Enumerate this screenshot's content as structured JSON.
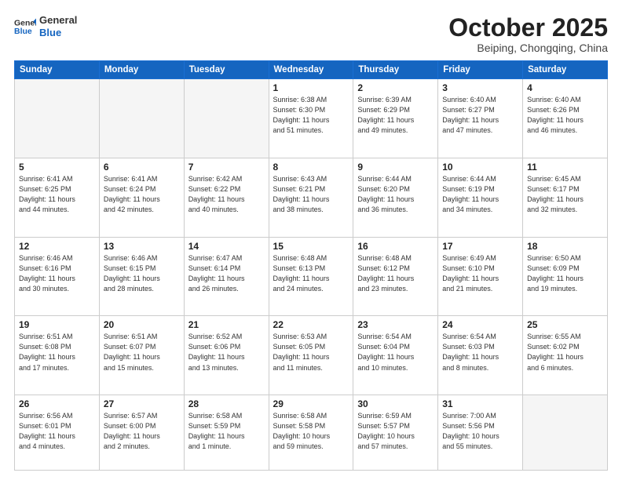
{
  "header": {
    "logo_line1": "General",
    "logo_line2": "Blue",
    "month_title": "October 2025",
    "location": "Beiping, Chongqing, China"
  },
  "weekdays": [
    "Sunday",
    "Monday",
    "Tuesday",
    "Wednesday",
    "Thursday",
    "Friday",
    "Saturday"
  ],
  "weeks": [
    [
      {
        "num": "",
        "info": ""
      },
      {
        "num": "",
        "info": ""
      },
      {
        "num": "",
        "info": ""
      },
      {
        "num": "1",
        "info": "Sunrise: 6:38 AM\nSunset: 6:30 PM\nDaylight: 11 hours\nand 51 minutes."
      },
      {
        "num": "2",
        "info": "Sunrise: 6:39 AM\nSunset: 6:29 PM\nDaylight: 11 hours\nand 49 minutes."
      },
      {
        "num": "3",
        "info": "Sunrise: 6:40 AM\nSunset: 6:27 PM\nDaylight: 11 hours\nand 47 minutes."
      },
      {
        "num": "4",
        "info": "Sunrise: 6:40 AM\nSunset: 6:26 PM\nDaylight: 11 hours\nand 46 minutes."
      }
    ],
    [
      {
        "num": "5",
        "info": "Sunrise: 6:41 AM\nSunset: 6:25 PM\nDaylight: 11 hours\nand 44 minutes."
      },
      {
        "num": "6",
        "info": "Sunrise: 6:41 AM\nSunset: 6:24 PM\nDaylight: 11 hours\nand 42 minutes."
      },
      {
        "num": "7",
        "info": "Sunrise: 6:42 AM\nSunset: 6:22 PM\nDaylight: 11 hours\nand 40 minutes."
      },
      {
        "num": "8",
        "info": "Sunrise: 6:43 AM\nSunset: 6:21 PM\nDaylight: 11 hours\nand 38 minutes."
      },
      {
        "num": "9",
        "info": "Sunrise: 6:44 AM\nSunset: 6:20 PM\nDaylight: 11 hours\nand 36 minutes."
      },
      {
        "num": "10",
        "info": "Sunrise: 6:44 AM\nSunset: 6:19 PM\nDaylight: 11 hours\nand 34 minutes."
      },
      {
        "num": "11",
        "info": "Sunrise: 6:45 AM\nSunset: 6:17 PM\nDaylight: 11 hours\nand 32 minutes."
      }
    ],
    [
      {
        "num": "12",
        "info": "Sunrise: 6:46 AM\nSunset: 6:16 PM\nDaylight: 11 hours\nand 30 minutes."
      },
      {
        "num": "13",
        "info": "Sunrise: 6:46 AM\nSunset: 6:15 PM\nDaylight: 11 hours\nand 28 minutes."
      },
      {
        "num": "14",
        "info": "Sunrise: 6:47 AM\nSunset: 6:14 PM\nDaylight: 11 hours\nand 26 minutes."
      },
      {
        "num": "15",
        "info": "Sunrise: 6:48 AM\nSunset: 6:13 PM\nDaylight: 11 hours\nand 24 minutes."
      },
      {
        "num": "16",
        "info": "Sunrise: 6:48 AM\nSunset: 6:12 PM\nDaylight: 11 hours\nand 23 minutes."
      },
      {
        "num": "17",
        "info": "Sunrise: 6:49 AM\nSunset: 6:10 PM\nDaylight: 11 hours\nand 21 minutes."
      },
      {
        "num": "18",
        "info": "Sunrise: 6:50 AM\nSunset: 6:09 PM\nDaylight: 11 hours\nand 19 minutes."
      }
    ],
    [
      {
        "num": "19",
        "info": "Sunrise: 6:51 AM\nSunset: 6:08 PM\nDaylight: 11 hours\nand 17 minutes."
      },
      {
        "num": "20",
        "info": "Sunrise: 6:51 AM\nSunset: 6:07 PM\nDaylight: 11 hours\nand 15 minutes."
      },
      {
        "num": "21",
        "info": "Sunrise: 6:52 AM\nSunset: 6:06 PM\nDaylight: 11 hours\nand 13 minutes."
      },
      {
        "num": "22",
        "info": "Sunrise: 6:53 AM\nSunset: 6:05 PM\nDaylight: 11 hours\nand 11 minutes."
      },
      {
        "num": "23",
        "info": "Sunrise: 6:54 AM\nSunset: 6:04 PM\nDaylight: 11 hours\nand 10 minutes."
      },
      {
        "num": "24",
        "info": "Sunrise: 6:54 AM\nSunset: 6:03 PM\nDaylight: 11 hours\nand 8 minutes."
      },
      {
        "num": "25",
        "info": "Sunrise: 6:55 AM\nSunset: 6:02 PM\nDaylight: 11 hours\nand 6 minutes."
      }
    ],
    [
      {
        "num": "26",
        "info": "Sunrise: 6:56 AM\nSunset: 6:01 PM\nDaylight: 11 hours\nand 4 minutes."
      },
      {
        "num": "27",
        "info": "Sunrise: 6:57 AM\nSunset: 6:00 PM\nDaylight: 11 hours\nand 2 minutes."
      },
      {
        "num": "28",
        "info": "Sunrise: 6:58 AM\nSunset: 5:59 PM\nDaylight: 11 hours\nand 1 minute."
      },
      {
        "num": "29",
        "info": "Sunrise: 6:58 AM\nSunset: 5:58 PM\nDaylight: 10 hours\nand 59 minutes."
      },
      {
        "num": "30",
        "info": "Sunrise: 6:59 AM\nSunset: 5:57 PM\nDaylight: 10 hours\nand 57 minutes."
      },
      {
        "num": "31",
        "info": "Sunrise: 7:00 AM\nSunset: 5:56 PM\nDaylight: 10 hours\nand 55 minutes."
      },
      {
        "num": "",
        "info": ""
      }
    ]
  ]
}
